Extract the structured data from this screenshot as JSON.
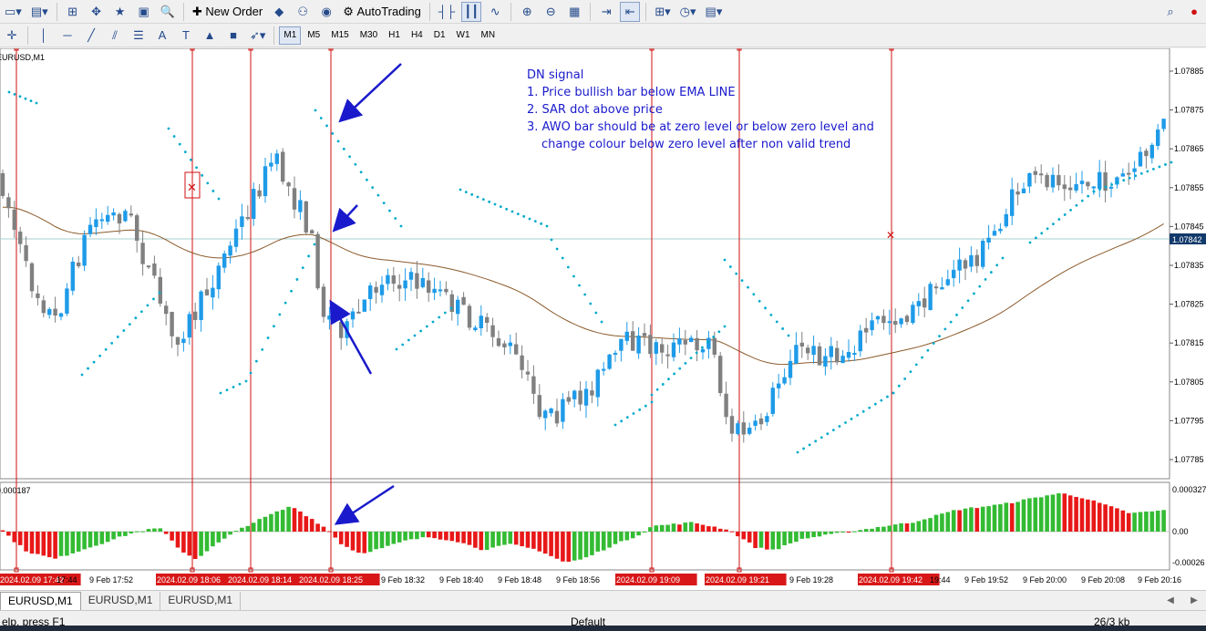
{
  "toolbar": {
    "new_order": "New Order",
    "autotrading": "AutoTrading",
    "timeframes": [
      "M1",
      "M5",
      "M15",
      "M30",
      "H1",
      "H4",
      "D1",
      "W1",
      "MN"
    ],
    "active_timeframe": "M1"
  },
  "chart": {
    "symbol_label": "EURUSD,M1",
    "current_price": "1.07842",
    "price_axis": [
      "1.07885",
      "1.07875",
      "1.07865",
      "1.07855",
      "1.07845",
      "1.07835",
      "1.07825",
      "1.07815",
      "1.07805",
      "1.07795",
      "1.07785"
    ],
    "indicator_axis": [
      "0.000327",
      "0.00",
      "-0.00026"
    ],
    "indicator_value": "0.000187",
    "time_labels": [
      "2024.02.09 17:42",
      "17:44",
      "9 Feb 17:52",
      "2024.02.09 18:06",
      "2024.02.09 18:14",
      "2024.02.09 18:25",
      "9 Feb 18:32",
      "9 Feb 18:40",
      "9 Feb 18:48",
      "9 Feb 18:56",
      "2024.02.09 19:09",
      "2024.02.09 19:21",
      "9 Feb 19:28",
      "2024.02.09 19:42",
      "19:44",
      "9 Feb 19:52",
      "9 Feb 20:00",
      "9 Feb 20:08",
      "9 Feb 20:16"
    ],
    "highlighted_times": [
      "2024.02.09 17:42",
      "2024.02.09 18:06",
      "2024.02.09 18:14",
      "2024.02.09 18:25",
      "2024.02.09 19:09",
      "2024.02.09 19:21",
      "2024.02.09 19:42"
    ],
    "colors": {
      "bull": "#1e9be8",
      "bear": "#808080",
      "sar": "#00aacc",
      "ema": "#8b5a2b",
      "awo_up": "#33bb33",
      "awo_down": "#e81818",
      "vline": "#d01010",
      "arrow": "#1a1acc"
    }
  },
  "annotation": {
    "title": "DN signal",
    "line1": "1. Price bullish bar below EMA LINE",
    "line2": "2. SAR dot above price",
    "line3": "3. AWO bar should be at zero level or below zero level and",
    "line3b": "change colour below zero level after non valid trend"
  },
  "tabs": [
    "EURUSD,M1",
    "EURUSD,M1",
    "EURUSD,M1"
  ],
  "status": {
    "help": "elp, press F1",
    "profile": "Default",
    "traffic": "26/3 kb"
  }
}
